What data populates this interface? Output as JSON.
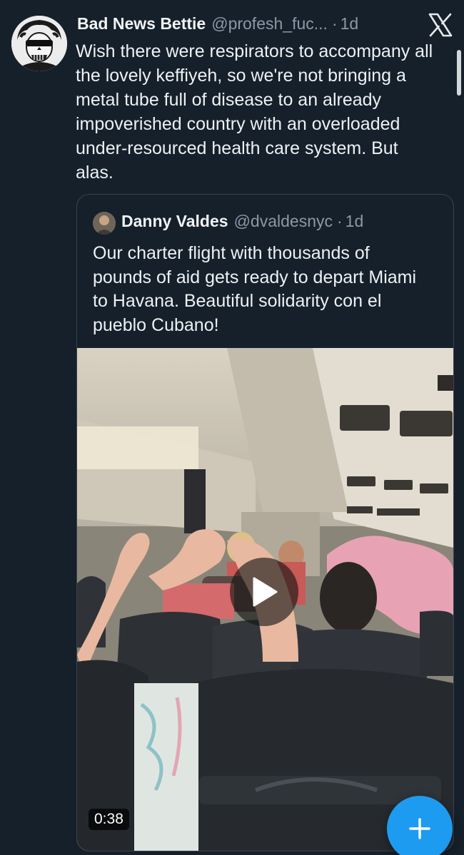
{
  "tweet": {
    "display_name": "Bad News Bettie",
    "handle": "@profesh_fuc...",
    "separator": "·",
    "time": "1d",
    "text": "Wish there were respirators to accompany all the lovely keffiyeh, so we're not bringing a metal tube full of disease to an already impoverished country with an overloaded under-resourced health care system. But alas.",
    "avatar_icon": "skull-avatar-icon"
  },
  "header": {
    "close_icon": "x-logo-icon"
  },
  "quoted_tweet": {
    "display_name": "Danny Valdes",
    "handle": "@dvaldesnyc",
    "separator": "·",
    "time": "1d",
    "text": "Our charter flight with thousands of pounds of aid gets ready to depart Miami to Havana. Beautiful solidarity con el pueblo Cubano!",
    "media": {
      "type": "video",
      "duration": "0:38",
      "play_icon": "play-icon"
    }
  },
  "compose": {
    "icon": "plus-icon",
    "color": "#1d9bf0"
  },
  "colors": {
    "background": "#15202b",
    "text": "#e7e9ea",
    "secondary": "#8b98a5",
    "border": "#38444d"
  }
}
